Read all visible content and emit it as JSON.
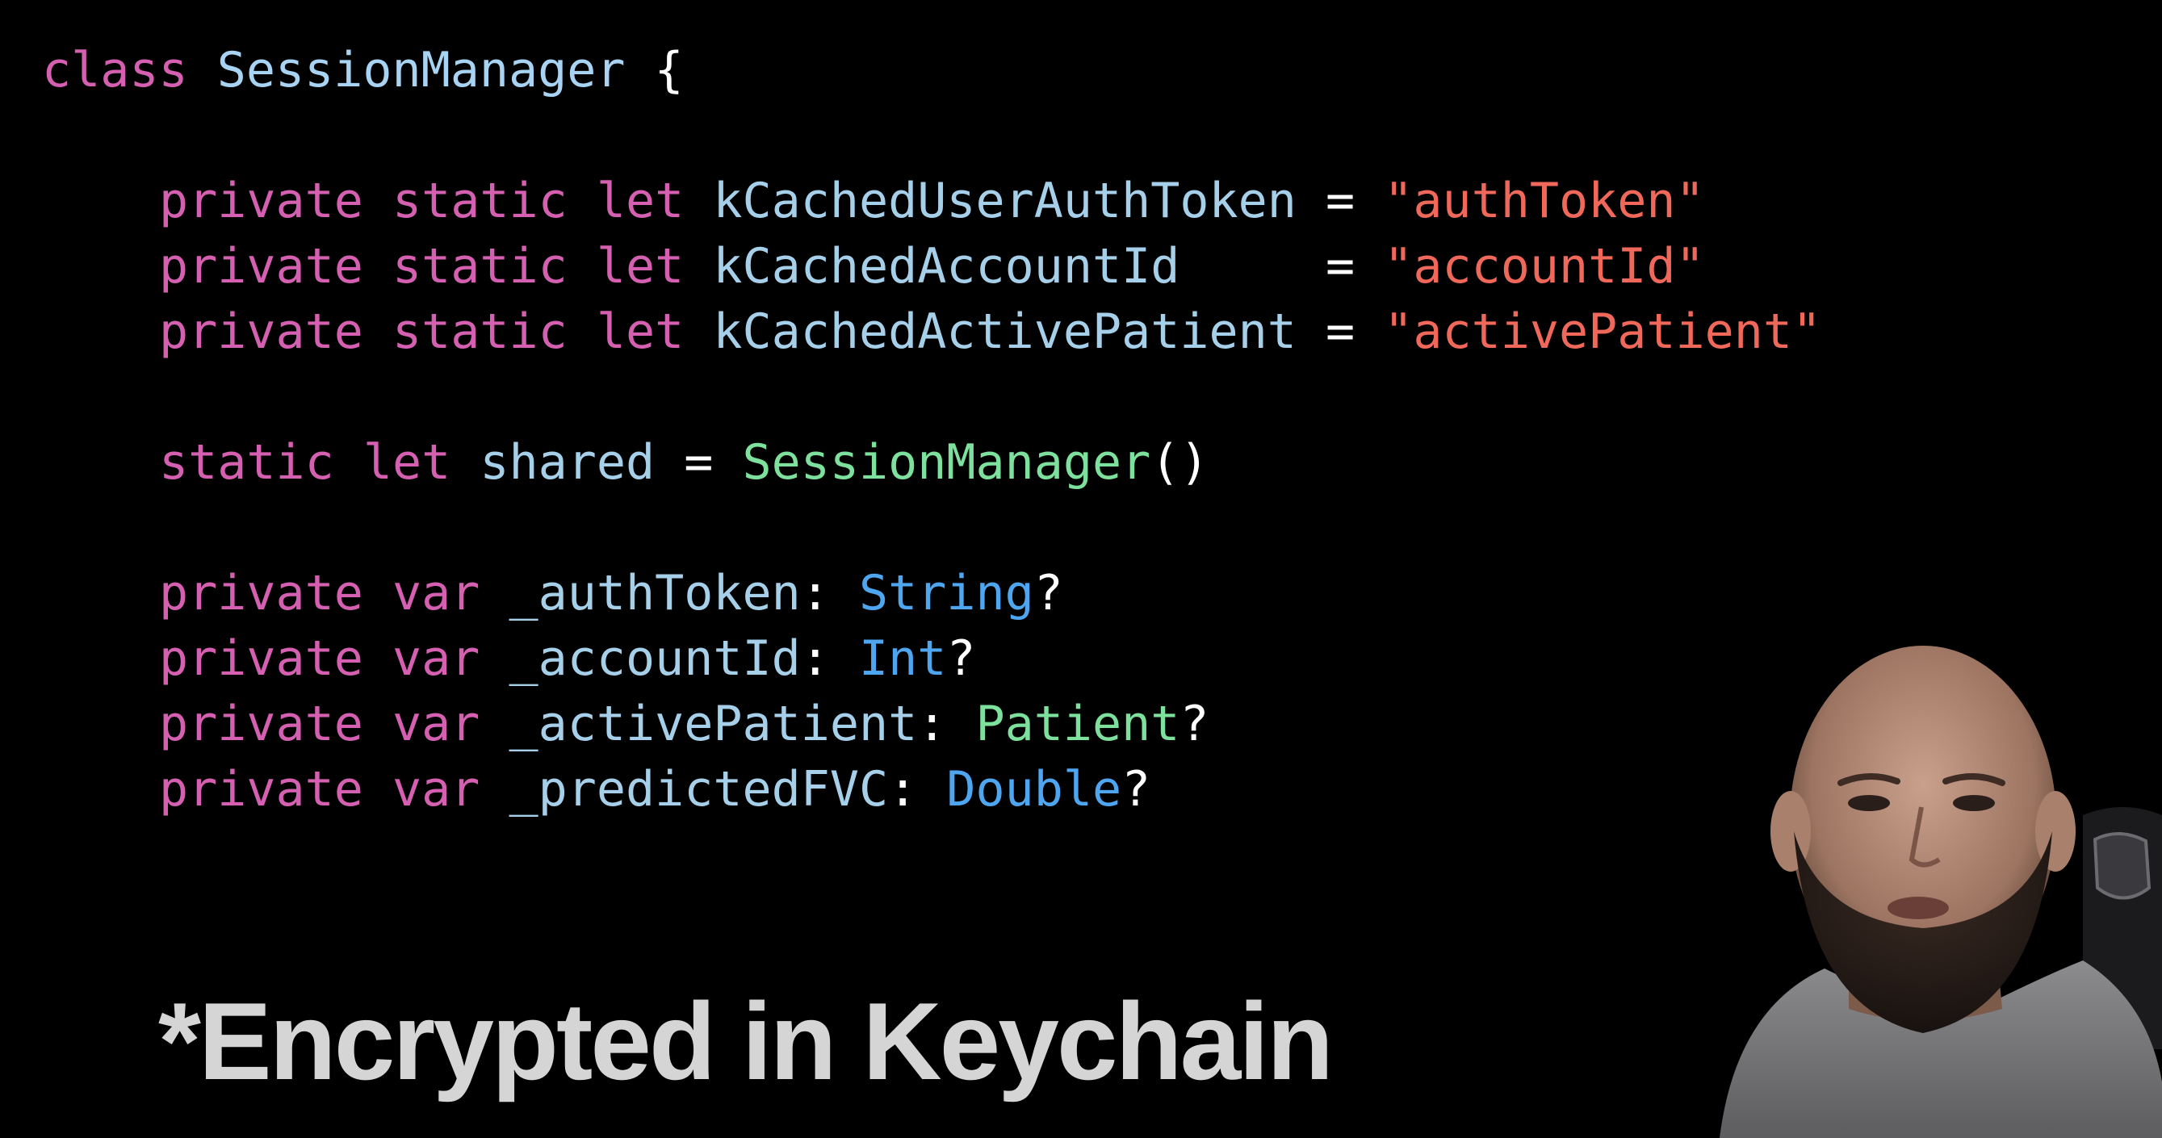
{
  "colors": {
    "background": "#000000",
    "keyword": "#d55fb0",
    "declaration_name": "#a8d3f2",
    "identifier": "#a6d0ea",
    "string_literal": "#f0685a",
    "type_name_system": "#4fa6f0",
    "type_name_project": "#7de09c",
    "plain": "#ffffff",
    "caption_text": "#d5d5d5"
  },
  "code": {
    "lines": [
      {
        "tokens": [
          {
            "text": "class",
            "kind": "keyword"
          },
          {
            "text": " ",
            "kind": "plain"
          },
          {
            "text": "SessionManager",
            "kind": "declaration_name"
          },
          {
            "text": " {",
            "kind": "plain"
          }
        ]
      },
      {
        "tokens": [
          {
            "text": "private",
            "kind": "keyword"
          },
          {
            "text": " ",
            "kind": "plain"
          },
          {
            "text": "static",
            "kind": "keyword"
          },
          {
            "text": " ",
            "kind": "plain"
          },
          {
            "text": "let",
            "kind": "keyword"
          },
          {
            "text": " ",
            "kind": "plain"
          },
          {
            "text": "kCachedUserAuthToken",
            "kind": "identifier"
          },
          {
            "text": " = ",
            "kind": "plain"
          },
          {
            "text": "\"authToken\"",
            "kind": "string_literal"
          }
        ]
      },
      {
        "tokens": [
          {
            "text": "private",
            "kind": "keyword"
          },
          {
            "text": " ",
            "kind": "plain"
          },
          {
            "text": "static",
            "kind": "keyword"
          },
          {
            "text": " ",
            "kind": "plain"
          },
          {
            "text": "let",
            "kind": "keyword"
          },
          {
            "text": " ",
            "kind": "plain"
          },
          {
            "text": "kCachedAccountId",
            "kind": "identifier"
          },
          {
            "text": "     = ",
            "kind": "plain"
          },
          {
            "text": "\"accountId\"",
            "kind": "string_literal"
          }
        ]
      },
      {
        "tokens": [
          {
            "text": "private",
            "kind": "keyword"
          },
          {
            "text": " ",
            "kind": "plain"
          },
          {
            "text": "static",
            "kind": "keyword"
          },
          {
            "text": " ",
            "kind": "plain"
          },
          {
            "text": "let",
            "kind": "keyword"
          },
          {
            "text": " ",
            "kind": "plain"
          },
          {
            "text": "kCachedActivePatient",
            "kind": "identifier"
          },
          {
            "text": " = ",
            "kind": "plain"
          },
          {
            "text": "\"activePatient\"",
            "kind": "string_literal"
          }
        ]
      },
      {
        "tokens": [
          {
            "text": "static",
            "kind": "keyword"
          },
          {
            "text": " ",
            "kind": "plain"
          },
          {
            "text": "let",
            "kind": "keyword"
          },
          {
            "text": " ",
            "kind": "plain"
          },
          {
            "text": "shared",
            "kind": "identifier"
          },
          {
            "text": " = ",
            "kind": "plain"
          },
          {
            "text": "SessionManager",
            "kind": "type_name_project"
          },
          {
            "text": "()",
            "kind": "plain"
          }
        ]
      },
      {
        "tokens": [
          {
            "text": "private",
            "kind": "keyword"
          },
          {
            "text": " ",
            "kind": "plain"
          },
          {
            "text": "var",
            "kind": "keyword"
          },
          {
            "text": " ",
            "kind": "plain"
          },
          {
            "text": "_authToken",
            "kind": "identifier"
          },
          {
            "text": ": ",
            "kind": "plain"
          },
          {
            "text": "String",
            "kind": "type_name_system"
          },
          {
            "text": "?",
            "kind": "plain"
          }
        ]
      },
      {
        "tokens": [
          {
            "text": "private",
            "kind": "keyword"
          },
          {
            "text": " ",
            "kind": "plain"
          },
          {
            "text": "var",
            "kind": "keyword"
          },
          {
            "text": " ",
            "kind": "plain"
          },
          {
            "text": "_accountId",
            "kind": "identifier"
          },
          {
            "text": ": ",
            "kind": "plain"
          },
          {
            "text": "Int",
            "kind": "type_name_system"
          },
          {
            "text": "?",
            "kind": "plain"
          }
        ]
      },
      {
        "tokens": [
          {
            "text": "private",
            "kind": "keyword"
          },
          {
            "text": " ",
            "kind": "plain"
          },
          {
            "text": "var",
            "kind": "keyword"
          },
          {
            "text": " ",
            "kind": "plain"
          },
          {
            "text": "_activePatient",
            "kind": "identifier"
          },
          {
            "text": ": ",
            "kind": "plain"
          },
          {
            "text": "Patient",
            "kind": "type_name_project"
          },
          {
            "text": "?",
            "kind": "plain"
          }
        ]
      },
      {
        "tokens": [
          {
            "text": "private",
            "kind": "keyword"
          },
          {
            "text": " ",
            "kind": "plain"
          },
          {
            "text": "var",
            "kind": "keyword"
          },
          {
            "text": " ",
            "kind": "plain"
          },
          {
            "text": "_predictedFVC",
            "kind": "identifier"
          },
          {
            "text": ": ",
            "kind": "plain"
          },
          {
            "text": "Double",
            "kind": "type_name_system"
          },
          {
            "text": "?",
            "kind": "plain"
          }
        ]
      }
    ]
  },
  "caption": {
    "text": "*Encrypted in Keychain"
  },
  "presenter": {
    "icon": "person-webcam-icon"
  }
}
